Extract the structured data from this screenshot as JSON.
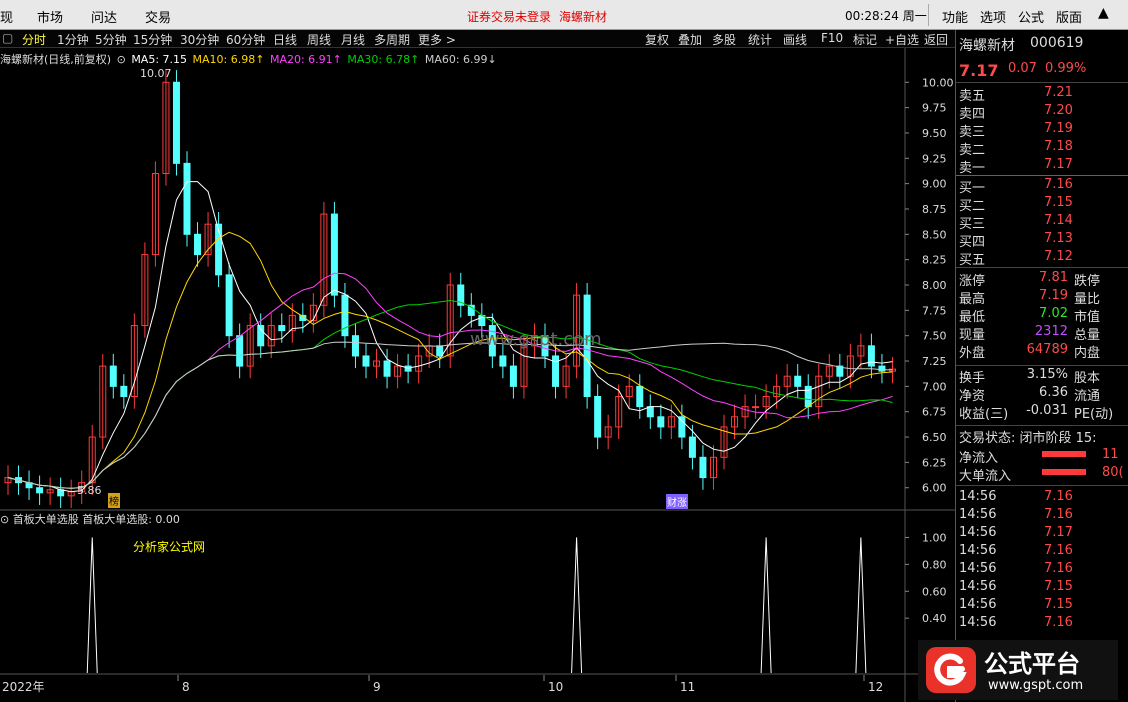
{
  "topbar": {
    "items": [
      "现",
      "市场",
      "问达",
      "交易"
    ],
    "notice": "证券交易未登录",
    "stock_name": "海螺新材",
    "clock": "00:28:24 周一",
    "right_items": [
      "功能",
      "选项",
      "公式",
      "版面"
    ],
    "close": "▲"
  },
  "periodbar": {
    "toggle": "▢",
    "periods": [
      "分时",
      "1分钟",
      "5分钟",
      "15分钟",
      "30分钟",
      "60分钟",
      "日线",
      "周线",
      "月线",
      "多周期",
      "更多 >"
    ],
    "active": "分时",
    "right_buttons": [
      "复权",
      "叠加",
      "多股",
      "统计",
      "画线",
      "F10",
      "标记",
      "+自选",
      "返回"
    ]
  },
  "legend": {
    "title": "海螺新材(日线,前复权)",
    "ma5": "MA5: 7.15",
    "ma10": "MA10: 6.98↑",
    "ma20": "MA20: 6.91↑",
    "ma30": "MA30: 6.78↑",
    "ma60": "MA60: 6.99↓",
    "sub_title": "首板大单选股",
    "sub_value": "首板大单选股: 0.00",
    "sub_text": "分析家公式网",
    "high_label": "10.07",
    "low_label": "5.86",
    "tag1": "榜",
    "tag2": "财涨"
  },
  "colors": {
    "up": "#ff3a3a",
    "down": "#54ffff",
    "ma5": "#ffffff",
    "ma10": "#ffd700",
    "ma20": "#ff40ff",
    "ma30": "#00d000",
    "ma60": "#cccccc",
    "accent": "#ffff00"
  },
  "chart_data": {
    "type": "candlestick",
    "ylim": [
      5.8,
      10.2
    ],
    "y_ticks": [
      10.0,
      9.75,
      9.5,
      9.25,
      9.0,
      8.75,
      8.5,
      8.25,
      8.0,
      7.75,
      7.5,
      7.25,
      7.0,
      6.75,
      6.5,
      6.25,
      6.0
    ],
    "x_labels": [
      "2022年",
      "8",
      "9",
      "10",
      "11",
      "12"
    ],
    "sub_ylim": [
      0,
      1.1
    ],
    "sub_ticks": [
      1.0,
      0.8,
      0.6,
      0.4
    ],
    "sub_spikes_at": [
      8,
      54,
      72,
      81
    ]
  },
  "quote": {
    "name": "海螺新材",
    "code": "000619",
    "price": "7.17",
    "change": "0.07",
    "pct": "0.99%",
    "asks": [
      [
        "卖五",
        "7.21"
      ],
      [
        "卖四",
        "7.20"
      ],
      [
        "卖三",
        "7.19"
      ],
      [
        "卖二",
        "7.18"
      ],
      [
        "卖一",
        "7.17"
      ]
    ],
    "bids": [
      [
        "买一",
        "7.16"
      ],
      [
        "买二",
        "7.15"
      ],
      [
        "买三",
        "7.14"
      ],
      [
        "买四",
        "7.13"
      ],
      [
        "买五",
        "7.12"
      ]
    ],
    "stats": [
      [
        "涨停",
        "7.81",
        "r",
        "跌停"
      ],
      [
        "最高",
        "7.19",
        "r",
        "量比"
      ],
      [
        "最低",
        "7.02",
        "g",
        "市值"
      ],
      [
        "现量",
        "2312",
        "m",
        "总量"
      ],
      [
        "外盘",
        "64789",
        "r",
        "内盘"
      ]
    ],
    "stats2": [
      [
        "换手",
        "3.15%",
        "股本"
      ],
      [
        "净资",
        "6.36",
        "流通"
      ],
      [
        "收益(三)",
        "-0.031",
        "PE(动)"
      ]
    ],
    "trade_status": "交易状态: 闭市阶段 15:",
    "netflow": [
      [
        "净流入",
        "11"
      ],
      [
        "大单流入",
        "80("
      ]
    ],
    "ticks": [
      [
        "14:56",
        "7.16"
      ],
      [
        "14:56",
        "7.16"
      ],
      [
        "14:56",
        "7.17"
      ],
      [
        "14:56",
        "7.16"
      ],
      [
        "14:56",
        "7.16"
      ],
      [
        "14:56",
        "7.15"
      ],
      [
        "14:56",
        "7.15"
      ],
      [
        "14:56",
        "7.16"
      ]
    ]
  },
  "watermark": "www.gspt.com",
  "logo": {
    "text": "公式平台",
    "url": "www.gspt.com"
  }
}
